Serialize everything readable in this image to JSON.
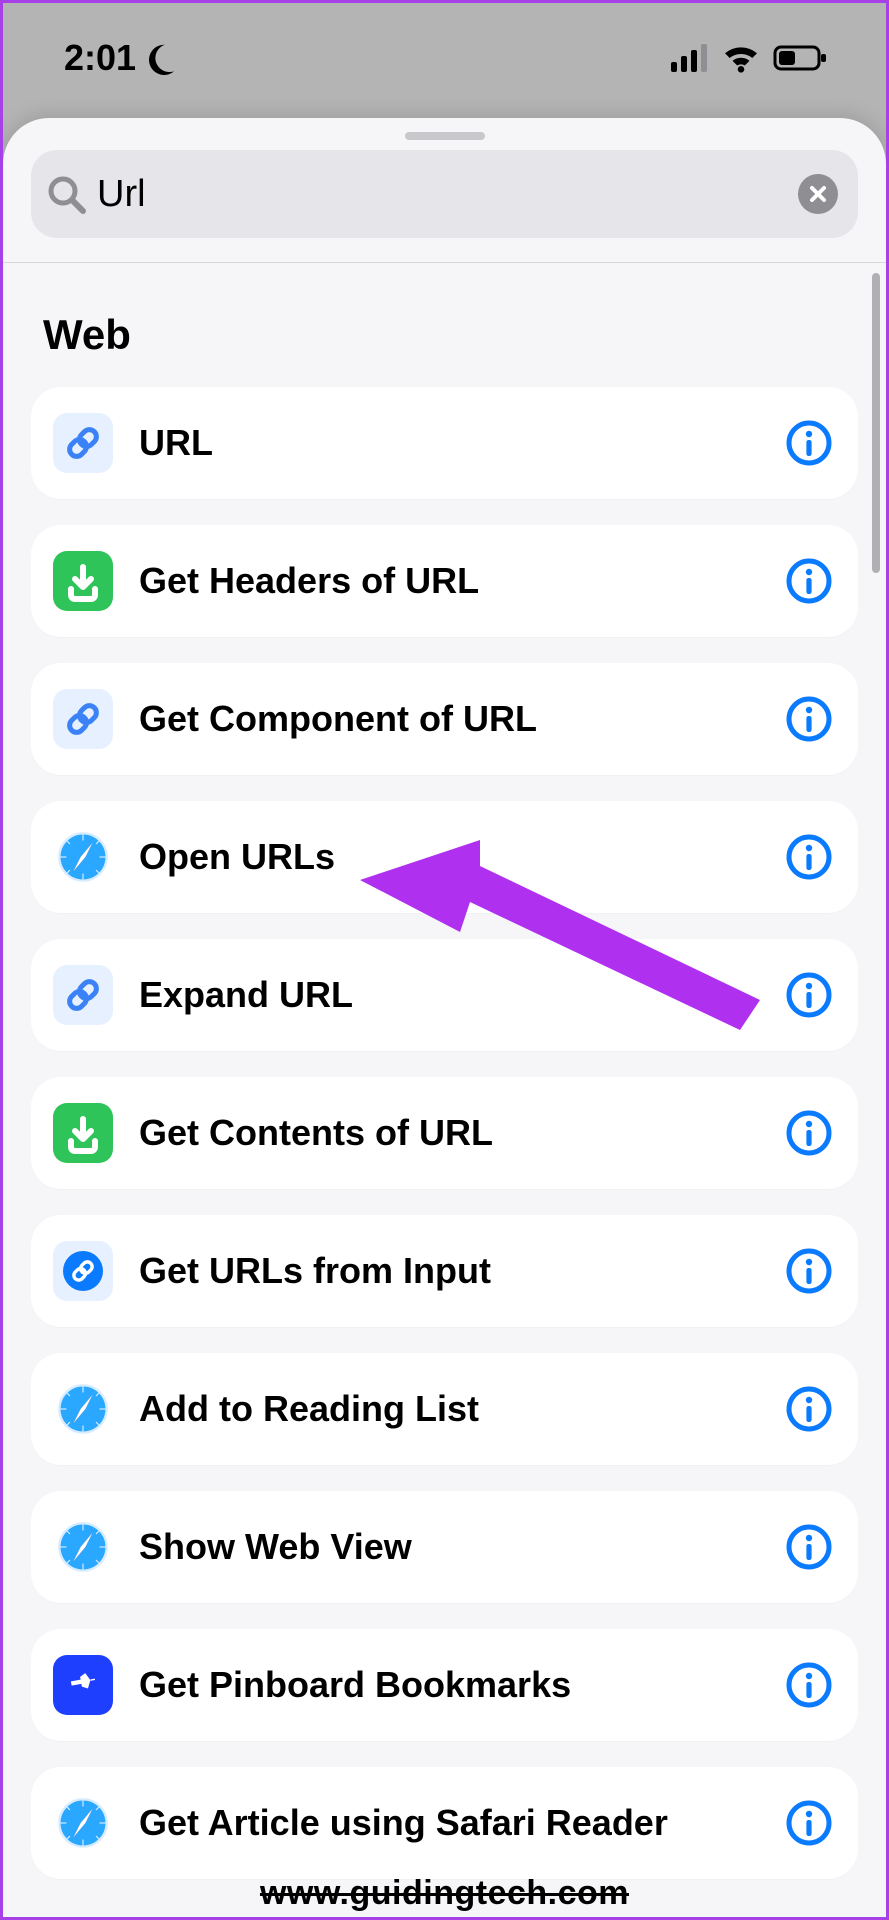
{
  "statusbar": {
    "time": "2:01"
  },
  "search": {
    "value": "Url"
  },
  "section": {
    "title": "Web"
  },
  "rows": [
    {
      "label": "URL",
      "icon": "link-light"
    },
    {
      "label": "Get Headers of URL",
      "icon": "download-green"
    },
    {
      "label": "Get Component of URL",
      "icon": "link-light"
    },
    {
      "label": "Open URLs",
      "icon": "safari"
    },
    {
      "label": "Expand URL",
      "icon": "link-light"
    },
    {
      "label": "Get Contents of URL",
      "icon": "download-green"
    },
    {
      "label": "Get URLs from Input",
      "icon": "link-blue-round"
    },
    {
      "label": "Add to Reading List",
      "icon": "safari"
    },
    {
      "label": "Show Web View",
      "icon": "safari"
    },
    {
      "label": "Get Pinboard Bookmarks",
      "icon": "pinboard"
    },
    {
      "label": "Get Article using Safari Reader",
      "icon": "safari"
    }
  ],
  "watermark": {
    "text": "www.guidingtech.com"
  },
  "colors": {
    "accent_blue": "#0a7aff",
    "info_ring": "#0a7aff",
    "green": "#2fc45a",
    "pale_blue": "#e6f0ff",
    "pinboard": "#1f3fff",
    "arrow": "#b030f0"
  }
}
